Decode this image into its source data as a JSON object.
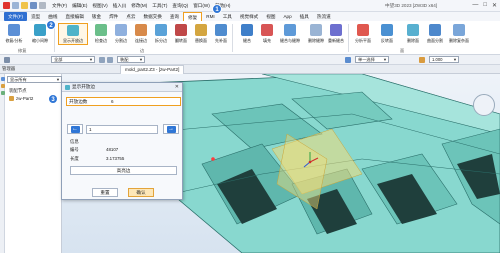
{
  "app": {
    "title": "中望3D 2023 [ZW3D x64]",
    "window_controls": [
      "—",
      "□",
      "✕"
    ]
  },
  "top_menu": [
    "文件(F)",
    "编辑(E)",
    "视图(V)",
    "插入(I)",
    "修改(M)",
    "工具(T)",
    "查询(Q)",
    "窗口(W)",
    "帮助(H)"
  ],
  "ribbon_tabs": [
    "文件(F)",
    "造型",
    "曲线",
    "直接编辑",
    "钣金",
    "焊件",
    "点云",
    "数据交换",
    "查询",
    "修复",
    "RMI",
    "工具",
    "视觉样式",
    "视图",
    "App",
    "插具",
    "热流道"
  ],
  "ribbon": {
    "buttons": [
      "修复/分析",
      "缩小间隙",
      "显示开放边",
      "检查边",
      "分割边",
      "连接边",
      "拆分边",
      "翻转面",
      "替换面",
      "先补面",
      "缝合",
      "填充",
      "缝合与缝隙",
      "删除缝隙",
      "重新缝合",
      "分析平面",
      "反转面",
      "删除面",
      "曲面分割",
      "删除复杂面"
    ],
    "groups": [
      "修复",
      "边",
      "面"
    ]
  },
  "toolbar": {
    "filter_value": "全部",
    "assembly_value": "单一选择",
    "zoom_value": "1.000",
    "view_mode": "装配"
  },
  "document": {
    "tab_label": "mold_part2.Z3 - [zw-Part2]",
    "manager_title": "管理器"
  },
  "tree": {
    "combo_value": "显示所有",
    "header": "装配节点",
    "items": [
      "zw-Part2"
    ]
  },
  "dialog": {
    "title": "显示开放边",
    "field_label": "开放边数",
    "field_value": "6",
    "nav_value": "1",
    "section_label": "信息",
    "id_label": "编号",
    "id_value": "48107",
    "length_label": "长度",
    "length_value": "3.173755",
    "highlight_button": "高亮边",
    "reset_button": "重置",
    "ok_button": "确认"
  },
  "callouts": [
    "1",
    "2",
    "3"
  ],
  "colors": {
    "accent": "#2f76d6",
    "highlight_border": "#f0a020",
    "model_teal": "#7fd6cc",
    "model_dark": "#2a6f6a",
    "plane_yellow": "#f2dd7a"
  }
}
